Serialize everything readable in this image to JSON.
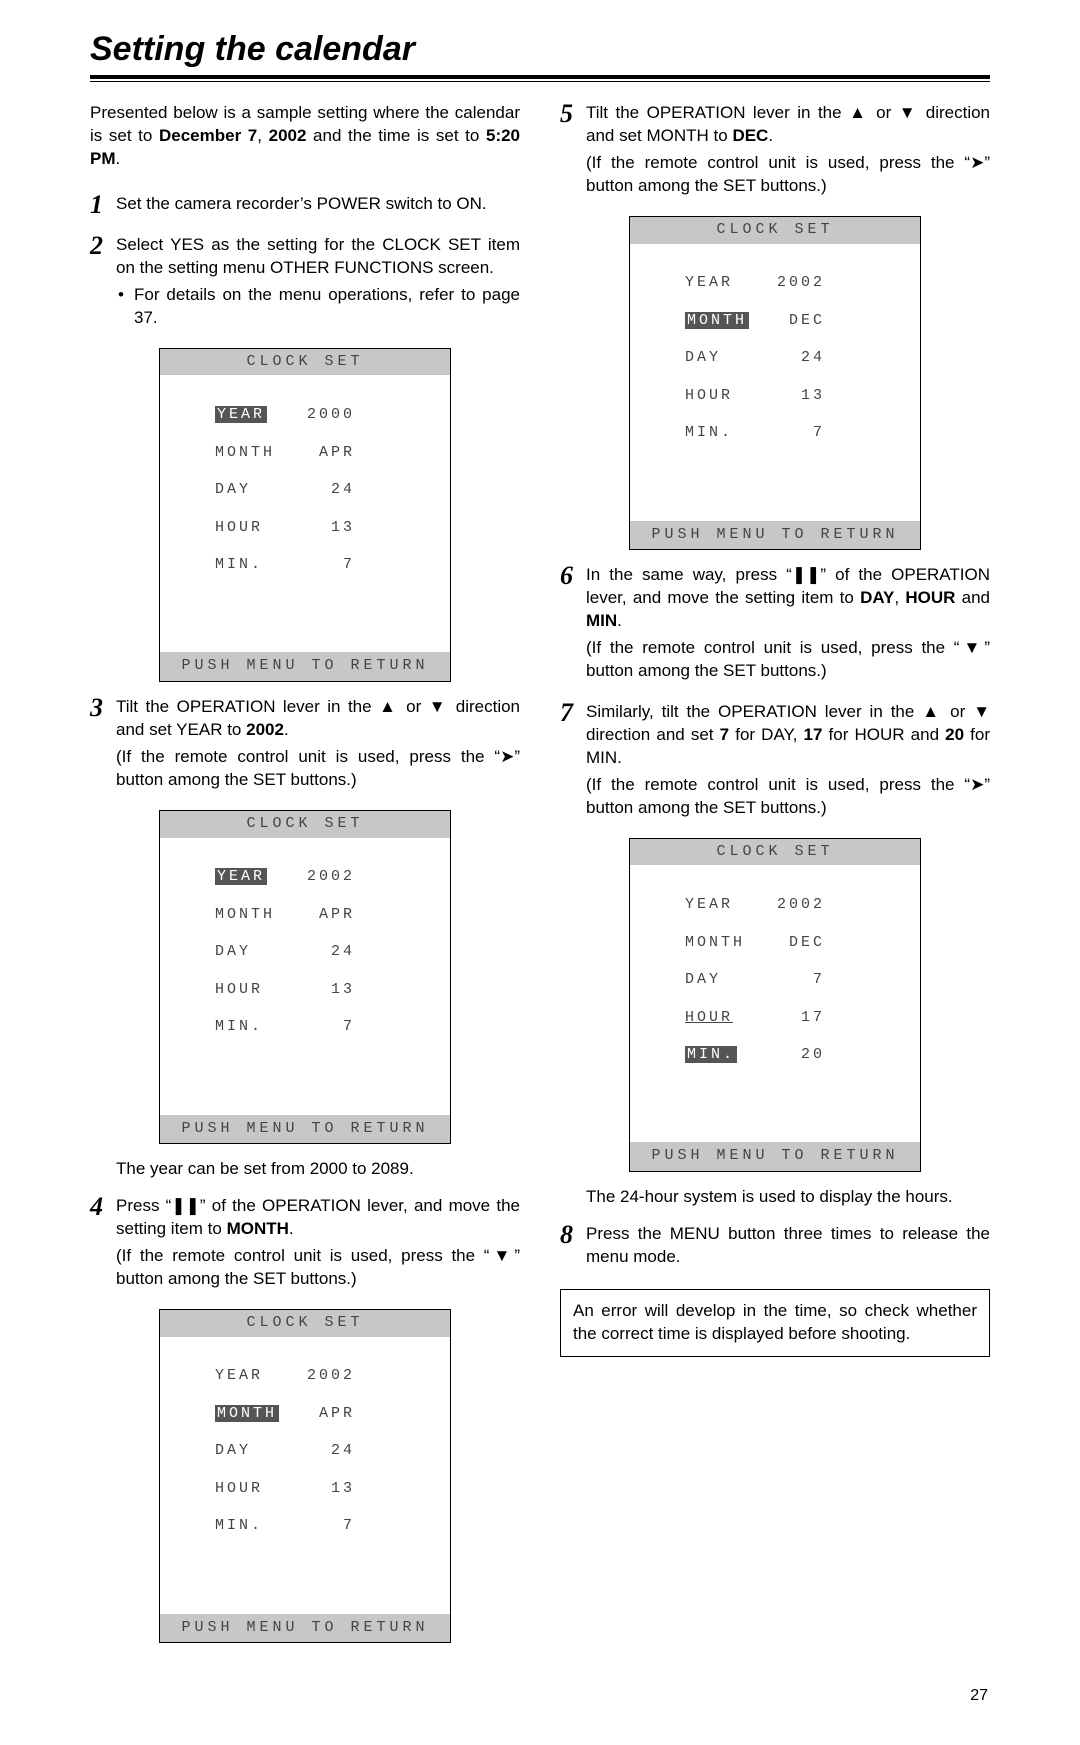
{
  "title": "Setting the calendar",
  "intro": "Presented below is a sample setting where the calendar is set to December 7, 2002 and the time is set to 5:20 PM.",
  "steps": {
    "s1": "Set the camera recorder’s POWER switch to ON.",
    "s2": "Select YES as the setting for the CLOCK SET item on the setting menu OTHER FUNCTIONS screen.",
    "s2_bullet": "For details on the menu operations, refer to page 37.",
    "s3a": "Tilt the OPERATION lever in the ▲ or ▼ direction and set YEAR to 2002.",
    "s3b": "(If the remote control unit is used, press the “➤” button among the SET buttons.)",
    "s3_note": "The year can be set from 2000 to 2089.",
    "s4a": "Press “❚❚” of the OPERATION lever, and move the setting item to MONTH.",
    "s4b": "(If the remote control unit is used, press the “▼” button among the SET buttons.)",
    "s5a": "Tilt the OPERATION lever in the ▲ or ▼ direction and set MONTH to DEC.",
    "s5b": "(If the remote control unit is used, press the “➤” button among the SET buttons.)",
    "s6a": "In the same way, press “❚❚” of the OPERATION lever, and move the setting item to DAY, HOUR and MIN.",
    "s6b": "(If the remote control unit is used, press the “▼” button among the SET buttons.)",
    "s7a": "Similarly, tilt the OPERATION lever in the ▲ or ▼ direction and set 7 for DAY, 17 for HOUR and 20 for MIN.",
    "s7b": "(If the remote control unit is used, press the “➤” button among the SET buttons.)",
    "s7_note": "The 24-hour system is used to display the hours.",
    "s8": "Press the MENU button three times to release the menu mode."
  },
  "warning": "An error will develop in the time, so check whether the correct time is displayed before shooting.",
  "screen_common": {
    "title": "CLOCK SET",
    "footer": "PUSH MENU TO RETURN",
    "labels": {
      "year": "YEAR",
      "month": "MONTH",
      "day": "DAY",
      "hour": "HOUR",
      "min": "MIN."
    }
  },
  "screens": {
    "a": {
      "year": "2000",
      "month": "APR",
      "day": "24",
      "hour": "13",
      "min": "7",
      "selected": "year"
    },
    "b": {
      "year": "2002",
      "month": "APR",
      "day": "24",
      "hour": "13",
      "min": "7",
      "selected": "year"
    },
    "c": {
      "year": "2002",
      "month": "APR",
      "day": "24",
      "hour": "13",
      "min": "7",
      "selected": "month"
    },
    "d": {
      "year": "2002",
      "month": "DEC",
      "day": "24",
      "hour": "13",
      "min": "7",
      "selected": "month"
    },
    "e": {
      "year": "2002",
      "month": "DEC",
      "day": "7",
      "hour": "17",
      "min": "20",
      "selected": "min"
    }
  },
  "page_number": "27"
}
